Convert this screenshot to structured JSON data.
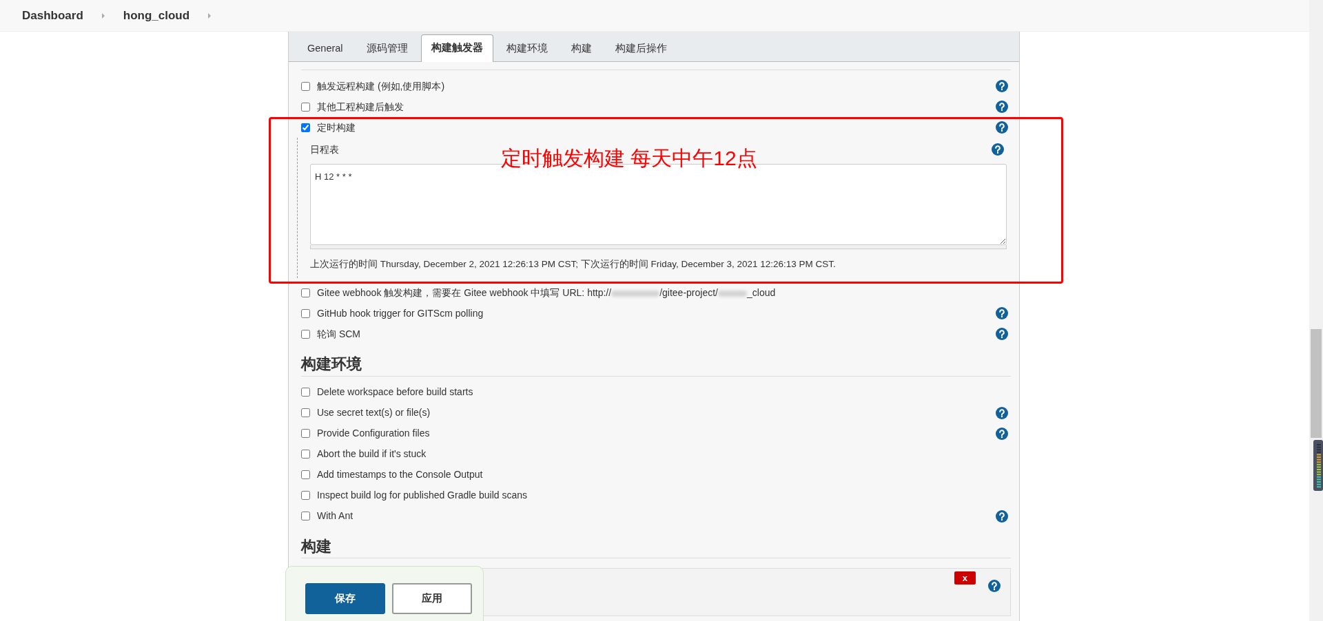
{
  "breadcrumbs": [
    {
      "label": "Dashboard"
    },
    {
      "label": "hong_cloud"
    }
  ],
  "tabs": [
    {
      "label": "General",
      "selected": false
    },
    {
      "label": "源码管理",
      "selected": false
    },
    {
      "label": "构建触发器",
      "selected": true
    },
    {
      "label": "构建环境",
      "selected": false
    },
    {
      "label": "构建",
      "selected": false
    },
    {
      "label": "构建后操作",
      "selected": false
    }
  ],
  "sections": [
    {
      "options": [
        {
          "label_parts": [
            "触发远程构建 (例如,使用脚本)"
          ],
          "checked": false,
          "help": true
        },
        {
          "label_parts": [
            "其他工程构建后触发"
          ],
          "checked": false,
          "help": true
        },
        {
          "label_parts": [
            "定时构建"
          ],
          "checked": true,
          "help": true,
          "schedule": {
            "label": "日程表",
            "help": true,
            "value": "H 12 * * *",
            "note": "上次运行的时间 Thursday, December 2, 2021 12:26:13 PM CST; 下次运行的时间 Friday, December 3, 2021 12:26:13 PM CST."
          }
        },
        {
          "label_parts": [
            "Gitee webhook 触发构建，需要在 Gitee webhook 中填写 URL: http://",
            "/gitee-project/",
            "_cloud"
          ],
          "checked": false,
          "help": false
        },
        {
          "label_parts": [
            "GitHub hook trigger for GITScm polling"
          ],
          "checked": false,
          "help": true
        },
        {
          "label_parts": [
            "轮询 SCM"
          ],
          "checked": false,
          "help": true
        }
      ]
    },
    {
      "heading": "构建环境",
      "options": [
        {
          "label_parts": [
            "Delete workspace before build starts"
          ],
          "checked": false,
          "help": false
        },
        {
          "label_parts": [
            "Use secret text(s) or file(s)"
          ],
          "checked": false,
          "help": true
        },
        {
          "label_parts": [
            "Provide Configuration files"
          ],
          "checked": false,
          "help": true
        },
        {
          "label_parts": [
            "Abort the build if it's stuck"
          ],
          "checked": false,
          "help": false
        },
        {
          "label_parts": [
            "Add timestamps to the Console Output"
          ],
          "checked": false,
          "help": false
        },
        {
          "label_parts": [
            "Inspect build log for published Gradle build scans"
          ],
          "checked": false,
          "help": false
        },
        {
          "label_parts": [
            "With Ant"
          ],
          "checked": false,
          "help": true
        }
      ]
    },
    {
      "heading": "构建",
      "step": {
        "delete_label": "x",
        "help": true
      }
    }
  ],
  "annotation": {
    "text": "定时触发构建 每天中午12点",
    "color": "#ff0000"
  },
  "buttons": [
    {
      "label": "保存",
      "kind": "primary"
    },
    {
      "label": "应用",
      "kind": "secondary"
    }
  ]
}
